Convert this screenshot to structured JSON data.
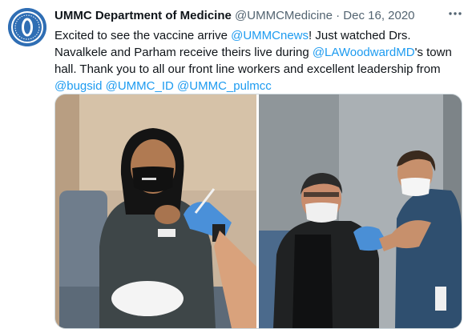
{
  "tweet": {
    "author_name": "UMMC Department of Medicine",
    "handle": "@UMMCMedicine",
    "separator": "·",
    "date": "Dec 16, 2020",
    "text": {
      "t1": "Excited to see the vaccine arrive ",
      "m1": "@UMMCnews",
      "t2": "! Just watched Drs. Navalkele and Parham receive theirs live during ",
      "m2": "@LAWoodwardMD",
      "t3": "'s town hall. Thank you to all our front line workers and excellent leadership from ",
      "m3": "@bugsid",
      "t4": " ",
      "m4": "@UMMC_ID",
      "t5": " ",
      "m5": "@UMMC_pulmcc"
    },
    "avatar_icon": "ummc-logo-icon",
    "more_icon": "more-options-icon",
    "media": [
      {
        "alt": "Healthcare worker in UMMC mask receiving vaccine",
        "icon": "photo-left"
      },
      {
        "alt": "Man receiving vaccine from healthcare worker",
        "icon": "photo-right"
      }
    ],
    "colors": {
      "link": "#1d9bf0",
      "text": "#0f1419",
      "muted": "#536471",
      "logo": "#2f6eb4"
    }
  }
}
